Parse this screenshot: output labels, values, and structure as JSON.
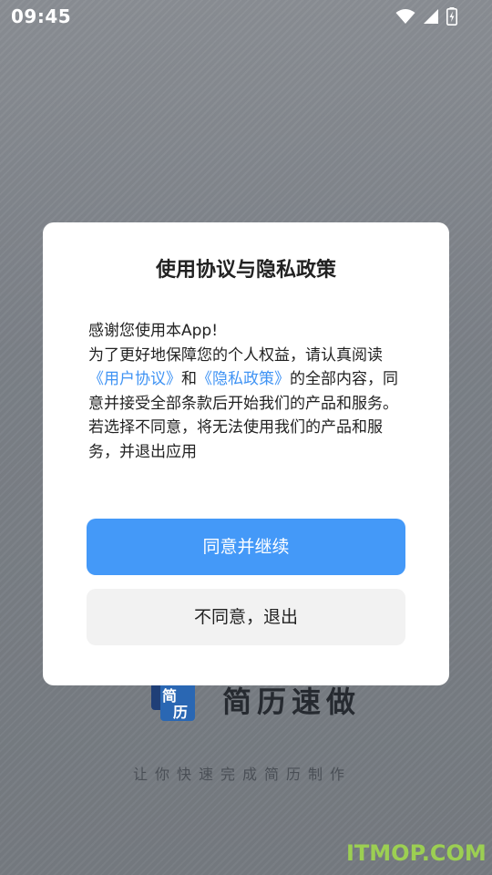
{
  "status_bar": {
    "time": "09:45",
    "icons": [
      "wifi-icon",
      "cell-signal-icon",
      "battery-charging-icon"
    ]
  },
  "background": {
    "app_name": "简历速做",
    "slogan": "让你快速完成简历制作",
    "logo_text_top": "简",
    "logo_text_bottom": "历",
    "watermark": "ITMOP.COM"
  },
  "dialog": {
    "title": "使用协议与隐私政策",
    "line1": "感谢您使用本App!",
    "line2_prefix": "为了更好地保障您的个人权益，请认真阅读",
    "user_agreement_link": "《用户协议》",
    "conjunction": "和",
    "privacy_policy_link": "《隐私政策》",
    "line2_suffix": "的全部内容，同意并接受全部条款后开始我们的产品和服务。",
    "line3": "若选择不同意，将无法使用我们的产品和服务，并退出应用",
    "agree_button": "同意并继续",
    "decline_button": "不同意，退出"
  },
  "colors": {
    "accent": "#4499f8",
    "link": "#3f93f4",
    "secondary_button": "#f2f2f2",
    "watermark": "#9ccf52"
  }
}
